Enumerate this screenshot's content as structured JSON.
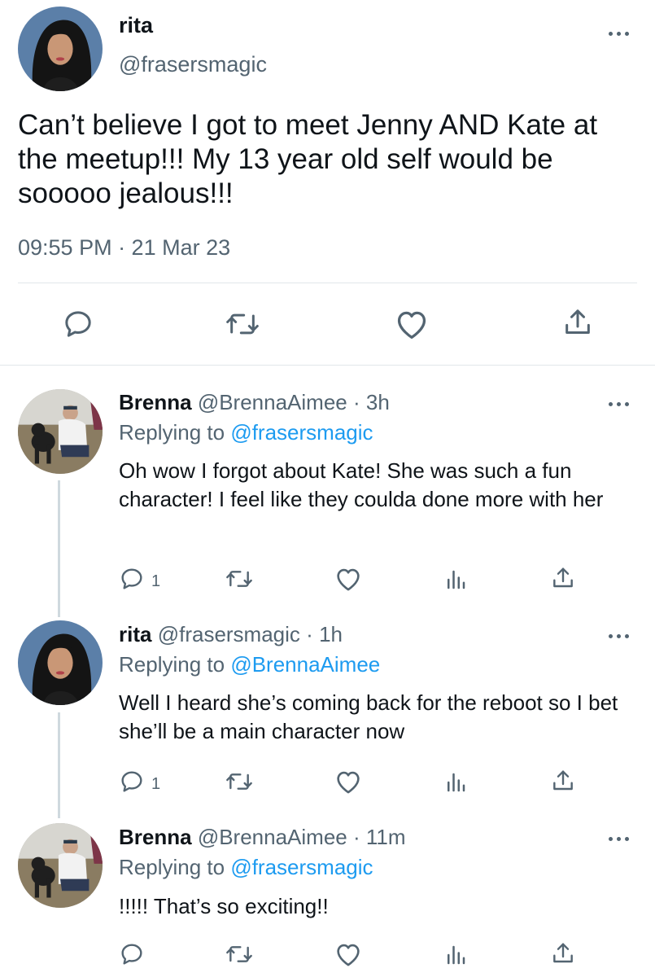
{
  "main_tweet": {
    "display_name": "rita",
    "handle": "@frasersmagic",
    "text": "Can’t believe I got to meet Jenny AND Kate at the meetup!!! My 13 year old self would be sooooo jealous!!!",
    "timestamp": "09:55 PM · 21 Mar 23",
    "actions": [
      "reply-icon",
      "retweet-icon",
      "like-icon",
      "share-icon"
    ]
  },
  "replies": [
    {
      "display_name": "Brenna",
      "handle": "@BrennaAimee",
      "separator": "·",
      "time": "3h",
      "replying_prefix": "Replying to",
      "replying_to": "@frasersmagic",
      "text": "Oh wow I forgot about Kate! She was such a fun character! I feel like they coulda done more with her",
      "reply_count": "1"
    },
    {
      "display_name": "rita",
      "handle": "@frasersmagic",
      "separator": "·",
      "time": "1h",
      "replying_prefix": "Replying to",
      "replying_to": "@BrennaAimee",
      "text": "Well I heard she’s coming back for the reboot so I bet she’ll be a main character now",
      "reply_count": "1"
    },
    {
      "display_name": "Brenna",
      "handle": "@BrennaAimee",
      "separator": "·",
      "time": "11m",
      "replying_prefix": "Replying to",
      "replying_to": "@frasersmagic",
      "text": "!!!!! That’s so exciting!!",
      "reply_count": ""
    }
  ],
  "colors": {
    "text": "#0f1419",
    "secondary": "#536471",
    "link": "#1d9bf0",
    "divider": "#e1e6ea"
  }
}
